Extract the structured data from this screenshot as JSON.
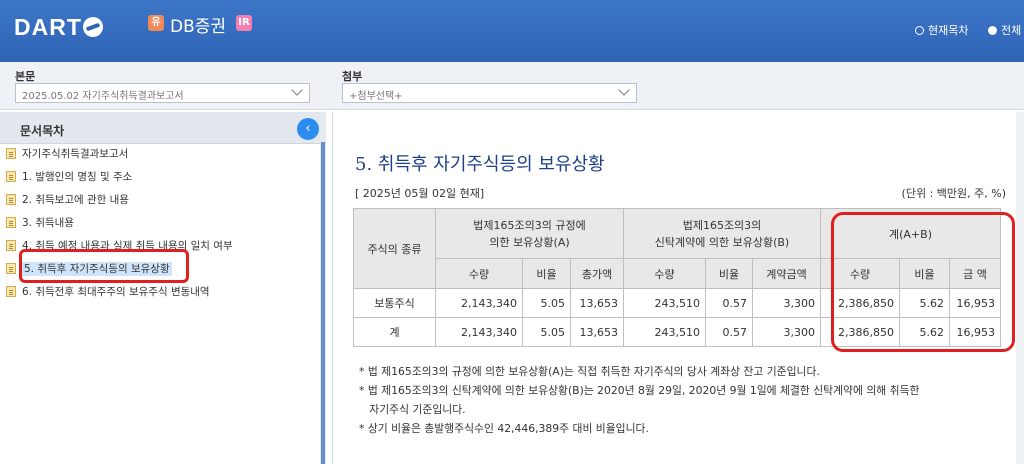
{
  "header": {
    "logo": "DART",
    "badge_left": "유",
    "company": "DB증권",
    "badge_right": "IR",
    "radio_current": "현재목차",
    "radio_all": "전체"
  },
  "selectors": {
    "main_label": "본문",
    "main_value": "2025.05.02  자기주식취득결과보고서",
    "attach_label": "첨부",
    "attach_value": "+첨부선택+"
  },
  "toc": {
    "title": "문서목차",
    "collapse": "‹",
    "items": [
      {
        "label": "자기주식취득결과보고서"
      },
      {
        "label": "1. 발행인의 명칭 및 주소"
      },
      {
        "label": "2. 취득보고에 관한 내용"
      },
      {
        "label": "3. 취득내용"
      },
      {
        "label": "4. 취득 예정 내용과 실제 취득 내용의 일치 여부"
      },
      {
        "label": "5. 취득후 자기주식등의 보유상황"
      },
      {
        "label": "6. 취득전후 최대주주의 보유주식 변동내역"
      }
    ]
  },
  "main": {
    "title": "5. 취득후 자기주식등의 보유상황",
    "date": "[    2025년 05월 02일    현재]",
    "unit": "(단위 : 백만원, 주, %)",
    "table": {
      "col_type": "주식의 종류",
      "group_a": "법제165조의3의 규정에\n의한 보유상황(A)",
      "group_b": "법제165조의3의\n신탁계약에 의한 보유상황(B)",
      "group_total": "계(A+B)",
      "sub_a": [
        "수량",
        "비율",
        "총가액"
      ],
      "sub_b": [
        "수량",
        "비율",
        "계약금액"
      ],
      "sub_total": [
        "수량",
        "비율",
        "금  액"
      ],
      "rows": [
        {
          "label": "보통주식",
          "cells": [
            "2,143,340",
            "5.05",
            "13,653",
            "243,510",
            "0.57",
            "3,300",
            "2,386,850",
            "5.62",
            "16,953"
          ]
        },
        {
          "label": "계",
          "cells": [
            "2,143,340",
            "5.05",
            "13,653",
            "243,510",
            "0.57",
            "3,300",
            "2,386,850",
            "5.62",
            "16,953"
          ]
        }
      ]
    },
    "notes": [
      "* 법 제165조의3의 규정에 의한 보유상황(A)는 직접 취득한 자기주식의 당사 계좌상 잔고 기준입니다.",
      "* 법 제165조의3의 신탁계약에 의한 보유상황(B)는 2020년 8월 29일, 2020년 9월 1일에 체결한 신탁계약에 의해 취득한",
      "   자기주식 기준입니다.",
      "* 상기 비율은 총발행주식수인 42,446,389주 대비 비율입니다."
    ]
  }
}
